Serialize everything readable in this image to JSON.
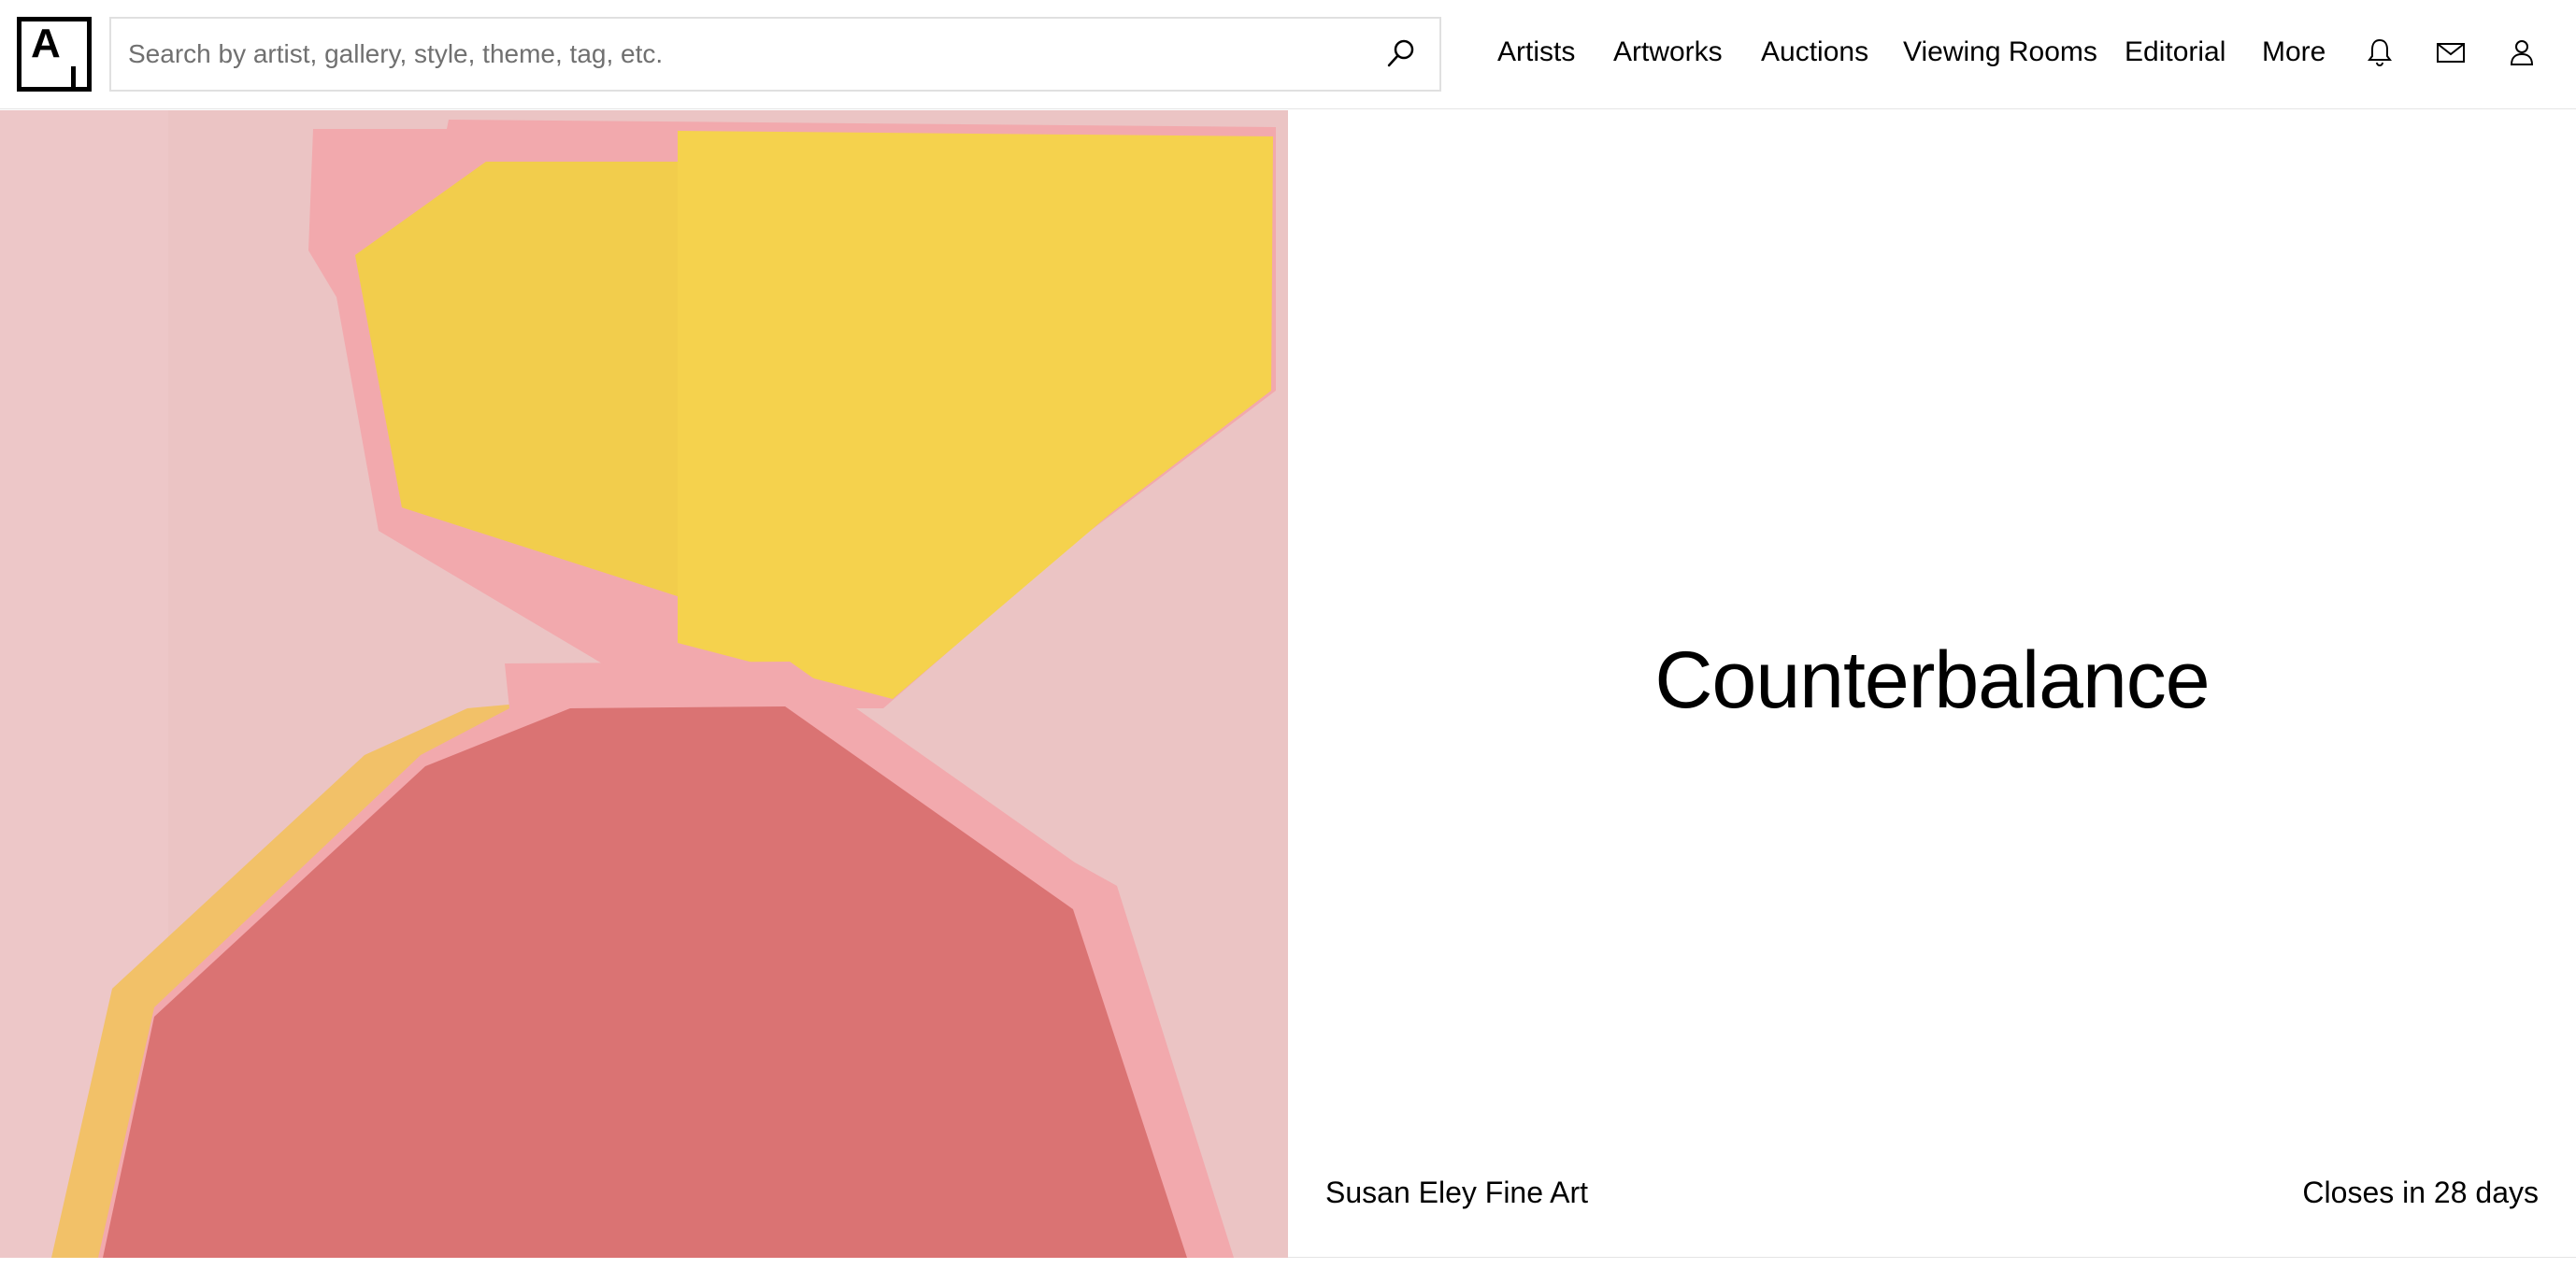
{
  "header": {
    "logo_letter": "A",
    "search": {
      "placeholder": "Search by artist, gallery, style, theme, tag, etc.",
      "value": ""
    },
    "nav": {
      "artists": "Artists",
      "artworks": "Artworks",
      "auctions": "Auctions",
      "viewing_rooms": "Viewing Rooms",
      "editorial": "Editorial",
      "more": "More"
    },
    "icons": [
      "search-icon",
      "bell-icon",
      "mail-icon",
      "user-icon"
    ]
  },
  "viewing_room": {
    "title": "Counterbalance",
    "partner": "Susan Eley Fine Art",
    "status": "Closes in 28 days"
  },
  "colors": {
    "background": "#ffffff",
    "text": "#000000",
    "artwork_pink": "#ebc4c4",
    "artwork_yellow": "#f5d24d",
    "artwork_coral": "#da7373",
    "artwork_light_pink": "#f2a9ad",
    "artwork_orange": "#f2c168"
  }
}
